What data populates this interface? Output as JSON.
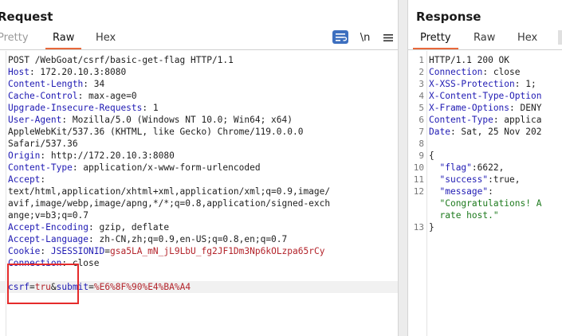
{
  "request": {
    "title": "Request",
    "tabs": [
      {
        "label": "Pretty",
        "state": "muted"
      },
      {
        "label": "Raw",
        "state": "active"
      },
      {
        "label": "Hex",
        "state": "normal"
      }
    ],
    "toolbar": {
      "newline_label": "\\n",
      "wrap_icon": "text-wrap-icon",
      "menu_icon": "hamburger-menu-icon"
    },
    "lines": [
      [
        {
          "t": "POST /WebGoat/csrf/basic-get-flag HTTP/1.1",
          "c": "val"
        }
      ],
      [
        {
          "t": "Host",
          "c": "key"
        },
        {
          "t": ": 172.20.10.3:8080",
          "c": "val"
        }
      ],
      [
        {
          "t": "Content-Length",
          "c": "key"
        },
        {
          "t": ": 34",
          "c": "val"
        }
      ],
      [
        {
          "t": "Cache-Control",
          "c": "key"
        },
        {
          "t": ": max-age=0",
          "c": "val"
        }
      ],
      [
        {
          "t": "Upgrade-Insecure-Requests",
          "c": "key"
        },
        {
          "t": ": 1",
          "c": "val"
        }
      ],
      [
        {
          "t": "User-Agent",
          "c": "key"
        },
        {
          "t": ": Mozilla/5.0 (Windows NT 10.0; Win64; x64)",
          "c": "val"
        }
      ],
      [
        {
          "t": "AppleWebKit/537.36 (KHTML, like Gecko) Chrome/119.0.0.0",
          "c": "val"
        }
      ],
      [
        {
          "t": "Safari/537.36",
          "c": "val"
        }
      ],
      [
        {
          "t": "Origin",
          "c": "key"
        },
        {
          "t": ": http://172.20.10.3:8080",
          "c": "val"
        }
      ],
      [
        {
          "t": "Content-Type",
          "c": "key"
        },
        {
          "t": ": application/x-www-form-urlencoded",
          "c": "val"
        }
      ],
      [
        {
          "t": "Accept",
          "c": "key"
        },
        {
          "t": ":",
          "c": "val"
        }
      ],
      [
        {
          "t": "text/html,application/xhtml+xml,application/xml;q=0.9,image/",
          "c": "val"
        }
      ],
      [
        {
          "t": "avif,image/webp,image/apng,*/*;q=0.8,application/signed-exch",
          "c": "val"
        }
      ],
      [
        {
          "t": "ange;v=b3;q=0.7",
          "c": "val"
        }
      ],
      [
        {
          "t": "Accept-Encoding",
          "c": "key"
        },
        {
          "t": ": gzip, deflate",
          "c": "val"
        }
      ],
      [
        {
          "t": "Accept-Language",
          "c": "key"
        },
        {
          "t": ": zh-CN,zh;q=0.9,en-US;q=0.8,en;q=0.7",
          "c": "val"
        }
      ],
      [
        {
          "t": "Cookie",
          "c": "key"
        },
        {
          "t": ": ",
          "c": "val"
        },
        {
          "t": "JSESSIONID",
          "c": "key"
        },
        {
          "t": "=",
          "c": "val"
        },
        {
          "t": "gsa5LA_mN_jL9LbU_fg2JF1Dm3Np6kOLzpa65rCy",
          "c": "red"
        }
      ],
      [
        {
          "t": "Connection",
          "c": "key"
        },
        {
          "t": ": close",
          "c": "val"
        }
      ],
      [
        {
          "t": "",
          "c": "val"
        }
      ],
      [
        {
          "t": "csrf",
          "c": "key"
        },
        {
          "t": "=",
          "c": "val"
        },
        {
          "t": "tru",
          "c": "red"
        },
        {
          "t": "&",
          "c": "val"
        },
        {
          "t": "submit",
          "c": "key"
        },
        {
          "t": "=",
          "c": "val"
        },
        {
          "t": "%E6%8F%90%E4%BA%A4",
          "c": "red"
        }
      ]
    ]
  },
  "response": {
    "title": "Response",
    "tabs": [
      {
        "label": "Pretty",
        "state": "active"
      },
      {
        "label": "Raw",
        "state": "normal"
      },
      {
        "label": "Hex",
        "state": "normal"
      }
    ],
    "lines": [
      {
        "n": "1",
        "parts": [
          {
            "t": "HTTP/1.1 200 OK",
            "c": "val"
          }
        ]
      },
      {
        "n": "2",
        "parts": [
          {
            "t": "Connection",
            "c": "key"
          },
          {
            "t": ": close",
            "c": "val"
          }
        ]
      },
      {
        "n": "3",
        "parts": [
          {
            "t": "X-XSS-Protection",
            "c": "key"
          },
          {
            "t": ": 1;",
            "c": "val"
          }
        ]
      },
      {
        "n": "4",
        "parts": [
          {
            "t": "X-Content-Type-Option",
            "c": "key"
          }
        ]
      },
      {
        "n": "5",
        "parts": [
          {
            "t": "X-Frame-Options",
            "c": "key"
          },
          {
            "t": ": DENY",
            "c": "val"
          }
        ]
      },
      {
        "n": "6",
        "parts": [
          {
            "t": "Content-Type",
            "c": "key"
          },
          {
            "t": ": applica",
            "c": "val"
          }
        ]
      },
      {
        "n": "7",
        "parts": [
          {
            "t": "Date",
            "c": "key"
          },
          {
            "t": ": Sat, 25 Nov 202",
            "c": "val"
          }
        ]
      },
      {
        "n": "8",
        "parts": [
          {
            "t": "",
            "c": "val"
          }
        ]
      },
      {
        "n": "9",
        "parts": [
          {
            "t": "{",
            "c": "val"
          }
        ]
      },
      {
        "n": "10",
        "parts": [
          {
            "t": "  ",
            "c": "val"
          },
          {
            "t": "\"flag\"",
            "c": "key"
          },
          {
            "t": ":6622,",
            "c": "num"
          }
        ]
      },
      {
        "n": "11",
        "parts": [
          {
            "t": "  ",
            "c": "val"
          },
          {
            "t": "\"success\"",
            "c": "key"
          },
          {
            "t": ":true,",
            "c": "val"
          }
        ]
      },
      {
        "n": "12",
        "parts": [
          {
            "t": "  ",
            "c": "val"
          },
          {
            "t": "\"message\"",
            "c": "key"
          },
          {
            "t": ":",
            "c": "val"
          }
        ]
      },
      {
        "n": "",
        "parts": [
          {
            "t": "  ",
            "c": "val"
          },
          {
            "t": "\"Congratulations! A",
            "c": "str"
          }
        ]
      },
      {
        "n": "",
        "parts": [
          {
            "t": "  ",
            "c": "val"
          },
          {
            "t": "rate host.\"",
            "c": "str"
          }
        ]
      },
      {
        "n": "13",
        "parts": [
          {
            "t": "}",
            "c": "val"
          }
        ]
      }
    ]
  },
  "highlight_color": "#e52b2b"
}
